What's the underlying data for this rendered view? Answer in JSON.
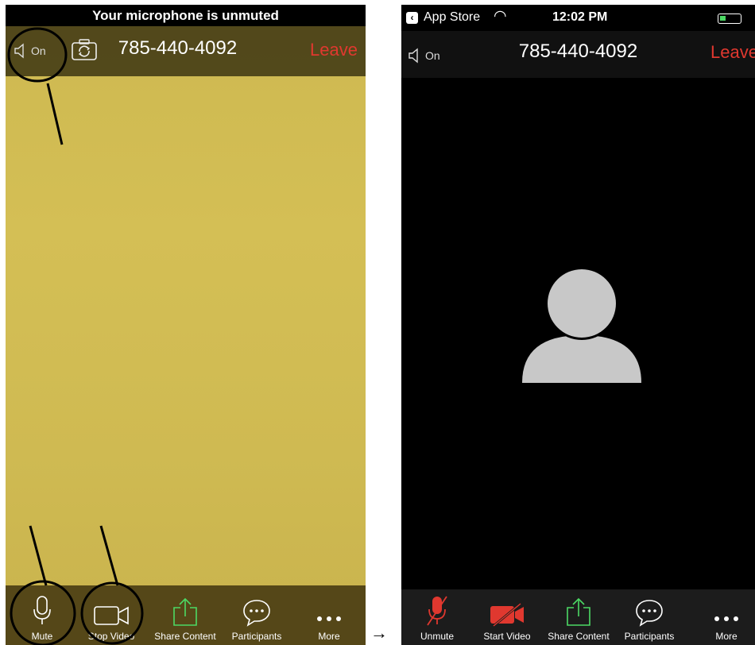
{
  "left_screen": {
    "banner": "Your microphone is unmuted",
    "speaker_label": "On",
    "phone_number": "785-440-4092",
    "leave_label": "Leave",
    "toolbar": {
      "mute": "Mute",
      "stop_video": "Stop Video",
      "share_content": "Share Content",
      "participants": "Participants",
      "more": "More"
    }
  },
  "right_screen": {
    "status_bar": {
      "back_app": "App Store",
      "time": "12:02 PM"
    },
    "speaker_label": "On",
    "phone_number": "785-440-4092",
    "leave_label": "Leave",
    "toolbar": {
      "unmute": "Unmute",
      "start_video": "Start Video",
      "share_content": "Share Content",
      "participants": "Participants",
      "more": "More"
    }
  },
  "transition_arrow": "→",
  "colors": {
    "leave_red": "#e0382f",
    "share_green": "#4cd964",
    "muted_red": "#e0382f"
  }
}
